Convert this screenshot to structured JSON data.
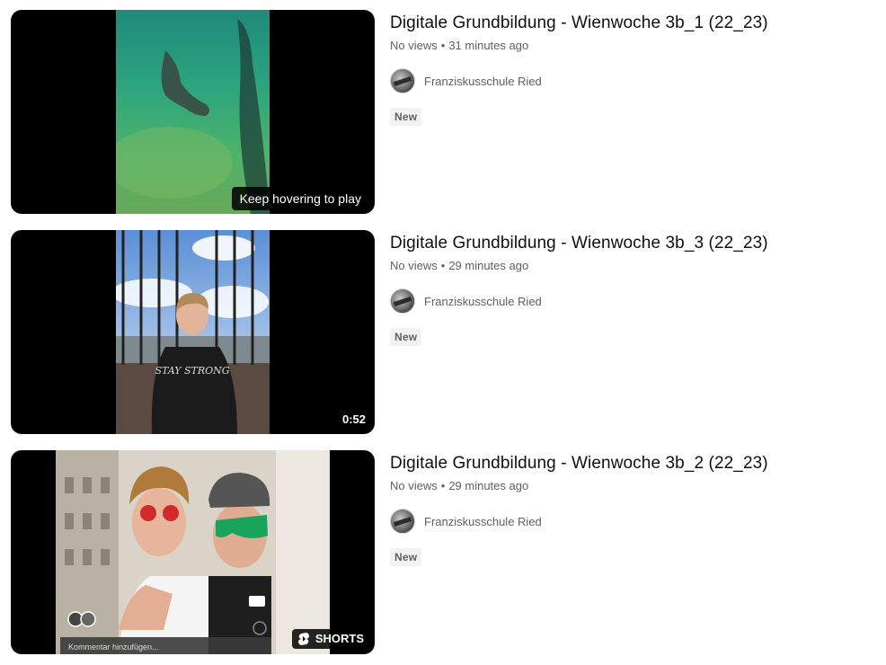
{
  "videos": [
    {
      "title": "Digitale Grundbildung - Wienwoche 3b_1 (22_23)",
      "views": "No views",
      "age": "31 minutes ago",
      "channel": "Franziskusschule Ried",
      "badge": "New",
      "overlay": "Keep hovering to play"
    },
    {
      "title": "Digitale Grundbildung - Wienwoche 3b_3 (22_23)",
      "views": "No views",
      "age": "29 minutes ago",
      "channel": "Franziskusschule Ried",
      "badge": "New",
      "duration": "0:52",
      "shirt_text": "STAY STRONG"
    },
    {
      "title": "Digitale Grundbildung - Wienwoche 3b_2 (22_23)",
      "views": "No views",
      "age": "29 minutes ago",
      "channel": "Franziskusschule Ried",
      "badge": "New",
      "shorts_label": "SHORTS",
      "comment_hint": "Kommentar hinzufügen..."
    }
  ],
  "separator": "•",
  "colors": {
    "meta_text": "#606060",
    "badge_bg": "#f2f2f2",
    "thumb_bg": "#000000"
  }
}
